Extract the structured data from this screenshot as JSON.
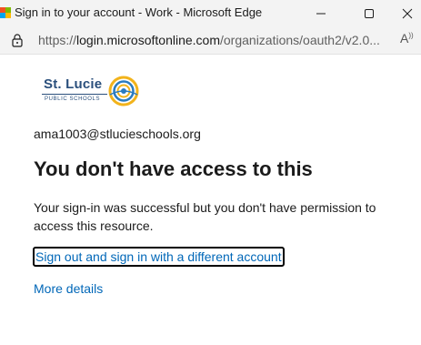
{
  "window": {
    "title": "Sign in to your account - Work - Microsoft Edge"
  },
  "addressbar": {
    "url_prefix": "https://",
    "url_host": "login.microsoftonline.com",
    "url_path": "/organizations/oauth2/v2.0..."
  },
  "logo": {
    "name": "St. Lucie",
    "subtitle": "PUBLIC SCHOOLS"
  },
  "content": {
    "email": "ama1003@stlucieschools.org",
    "heading": "You don't have access to this",
    "message": "Your sign-in was successful but you don't have permission to access this resource.",
    "signout_link": "Sign out and sign in with a different account",
    "more_details_link": "More details"
  },
  "colors": {
    "link": "#0067b8",
    "titlebar_bg": "#f3f3f3",
    "logo_blue": "#2a4f7c"
  },
  "icons": {
    "app": "microsoft-logo-icon",
    "minimize": "minimize-icon",
    "maximize": "maximize-icon",
    "close": "close-icon",
    "lock": "lock-icon",
    "read_aloud": "read-aloud-icon"
  }
}
